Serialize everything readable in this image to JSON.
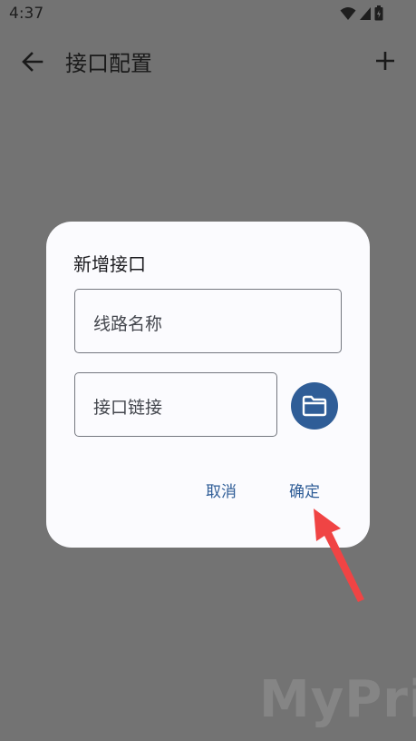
{
  "status_bar": {
    "time": "4:37",
    "icons": [
      "wifi-icon",
      "signal-icon",
      "battery-icon"
    ]
  },
  "app_bar": {
    "title": "接口配置",
    "back_icon": "arrow-left-icon",
    "add_icon": "plus-icon"
  },
  "dialog": {
    "title": "新增接口",
    "name_field": {
      "placeholder": "线路名称",
      "value": ""
    },
    "url_field": {
      "placeholder": "接口链接",
      "value": ""
    },
    "folder_icon": "folder-icon",
    "cancel_label": "取消",
    "ok_label": "确定"
  },
  "watermark": "MyPrice",
  "colors": {
    "scrim": "#737373",
    "dialog_bg": "#fbfbfe",
    "accent": "#2f5d97",
    "arrow": "#f04444"
  }
}
